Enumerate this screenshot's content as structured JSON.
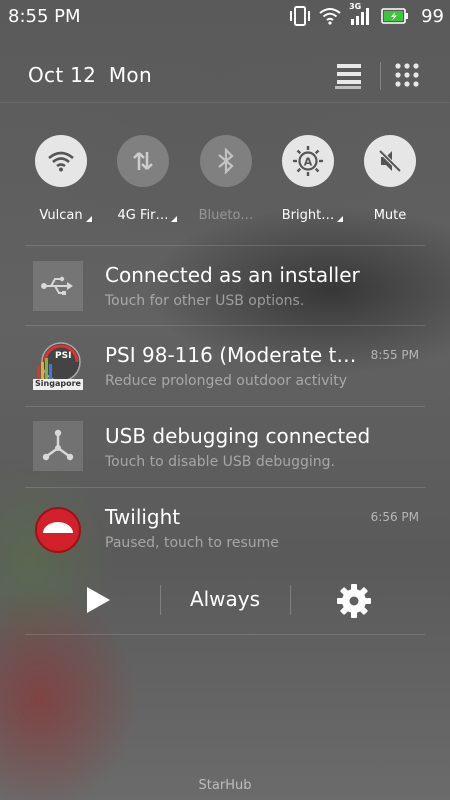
{
  "status_bar": {
    "time": "8:55 PM",
    "network_type": "3G",
    "battery_percent": "99",
    "icons": [
      "vibrate-icon",
      "wifi-icon",
      "signal-icon",
      "battery-icon"
    ]
  },
  "header": {
    "date": "Oct 12",
    "day": "Mon",
    "icons": [
      "list-icon",
      "grid-icon"
    ]
  },
  "toggles": [
    {
      "label": "Vulcan",
      "icon": "wifi-icon",
      "state": "on"
    },
    {
      "label": "4G Fir…",
      "icon": "data-arrows-icon",
      "state": "off"
    },
    {
      "label": "Blueto…",
      "icon": "bluetooth-icon",
      "state": "off"
    },
    {
      "label": "Bright…",
      "icon": "brightness-auto-icon",
      "state": "on"
    },
    {
      "label": "Mute",
      "icon": "mute-icon",
      "state": "on"
    }
  ],
  "notifications": [
    {
      "title": "Connected as an installer",
      "subtitle": "Touch for other USB options.",
      "time": "",
      "icon": "usb-icon"
    },
    {
      "title": "PSI  98-116 (Moderate t…",
      "subtitle": "Reduce prolonged outdoor activity",
      "time": "8:55 PM",
      "icon": "psi-singapore-app-icon",
      "icon_text": {
        "top": "PSI",
        "bottom": "Singapore"
      }
    },
    {
      "title": "USB debugging connected",
      "subtitle": "Touch to disable USB debugging.",
      "time": "",
      "icon": "usb-debug-icon"
    },
    {
      "title": "Twilight",
      "subtitle": "Paused, touch to resume",
      "time": "6:56 PM",
      "icon": "twilight-app-icon"
    }
  ],
  "media_controls": {
    "play_icon": "play-icon",
    "mode_label": "Always",
    "settings_icon": "settings-gear-icon"
  },
  "carrier": "StarHub",
  "colors": {
    "twilight_red": "#d3202a",
    "toggle_on": "#e6e6e6",
    "battery_green": "#3fc23f"
  }
}
